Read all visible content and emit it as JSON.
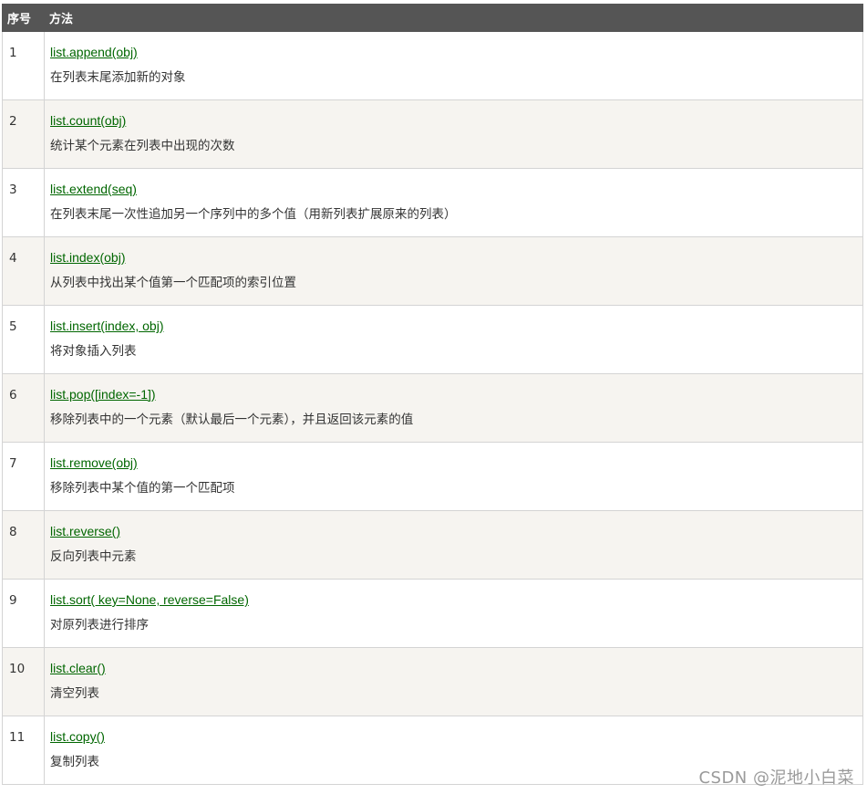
{
  "table": {
    "headers": {
      "number": "序号",
      "method": "方法"
    },
    "rows": [
      {
        "number": "1",
        "method": "list.append(obj)",
        "description": "在列表末尾添加新的对象"
      },
      {
        "number": "2",
        "method": "list.count(obj)",
        "description": "统计某个元素在列表中出现的次数"
      },
      {
        "number": "3",
        "method": "list.extend(seq)",
        "description": "在列表末尾一次性追加另一个序列中的多个值（用新列表扩展原来的列表）"
      },
      {
        "number": "4",
        "method": "list.index(obj)",
        "description": "从列表中找出某个值第一个匹配项的索引位置"
      },
      {
        "number": "5",
        "method": "list.insert(index, obj)",
        "description": "将对象插入列表"
      },
      {
        "number": "6",
        "method": "list.pop([index=-1])",
        "description": "移除列表中的一个元素（默认最后一个元素），并且返回该元素的值"
      },
      {
        "number": "7",
        "method": "list.remove(obj)",
        "description": "移除列表中某个值的第一个匹配项"
      },
      {
        "number": "8",
        "method": "list.reverse()",
        "description": "反向列表中元素"
      },
      {
        "number": "9",
        "method": "list.sort( key=None, reverse=False)",
        "description": "对原列表进行排序"
      },
      {
        "number": "10",
        "method": "list.clear()",
        "description": "清空列表"
      },
      {
        "number": "11",
        "method": "list.copy()",
        "description": "复制列表"
      }
    ]
  },
  "watermark": "CSDN @泥地小白菜",
  "colors": {
    "header_bg": "#555555",
    "link": "#006600",
    "row_alt": "#f6f4f0",
    "border": "#d4d4d4"
  }
}
